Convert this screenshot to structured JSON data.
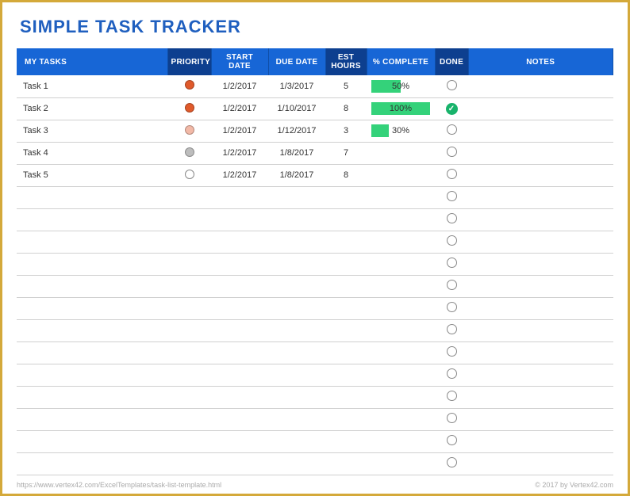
{
  "title": "SIMPLE TASK TRACKER",
  "columns": {
    "task": "MY TASKS",
    "priority": "PRIORITY",
    "start": "START DATE",
    "due": "DUE DATE",
    "est": "EST HOURS",
    "pct": "% COMPLETE",
    "done": "DONE",
    "notes": "NOTES"
  },
  "rows": [
    {
      "task": "Task 1",
      "priority": "high",
      "start": "1/2/2017",
      "due": "1/3/2017",
      "est": "5",
      "pct": 50,
      "pct_label": "50%",
      "done": false
    },
    {
      "task": "Task 2",
      "priority": "high",
      "start": "1/2/2017",
      "due": "1/10/2017",
      "est": "8",
      "pct": 100,
      "pct_label": "100%",
      "done": true
    },
    {
      "task": "Task 3",
      "priority": "med",
      "start": "1/2/2017",
      "due": "1/12/2017",
      "est": "3",
      "pct": 30,
      "pct_label": "30%",
      "done": false
    },
    {
      "task": "Task 4",
      "priority": "low",
      "start": "1/2/2017",
      "due": "1/8/2017",
      "est": "7",
      "pct": null,
      "pct_label": "",
      "done": false
    },
    {
      "task": "Task 5",
      "priority": "none",
      "start": "1/2/2017",
      "due": "1/8/2017",
      "est": "8",
      "pct": null,
      "pct_label": "",
      "done": false
    },
    {
      "task": "",
      "priority": "",
      "start": "",
      "due": "",
      "est": "",
      "pct": null,
      "pct_label": "",
      "done": false
    },
    {
      "task": "",
      "priority": "",
      "start": "",
      "due": "",
      "est": "",
      "pct": null,
      "pct_label": "",
      "done": false
    },
    {
      "task": "",
      "priority": "",
      "start": "",
      "due": "",
      "est": "",
      "pct": null,
      "pct_label": "",
      "done": false
    },
    {
      "task": "",
      "priority": "",
      "start": "",
      "due": "",
      "est": "",
      "pct": null,
      "pct_label": "",
      "done": false
    },
    {
      "task": "",
      "priority": "",
      "start": "",
      "due": "",
      "est": "",
      "pct": null,
      "pct_label": "",
      "done": false
    },
    {
      "task": "",
      "priority": "",
      "start": "",
      "due": "",
      "est": "",
      "pct": null,
      "pct_label": "",
      "done": false
    },
    {
      "task": "",
      "priority": "",
      "start": "",
      "due": "",
      "est": "",
      "pct": null,
      "pct_label": "",
      "done": false
    },
    {
      "task": "",
      "priority": "",
      "start": "",
      "due": "",
      "est": "",
      "pct": null,
      "pct_label": "",
      "done": false
    },
    {
      "task": "",
      "priority": "",
      "start": "",
      "due": "",
      "est": "",
      "pct": null,
      "pct_label": "",
      "done": false
    },
    {
      "task": "",
      "priority": "",
      "start": "",
      "due": "",
      "est": "",
      "pct": null,
      "pct_label": "",
      "done": false
    },
    {
      "task": "",
      "priority": "",
      "start": "",
      "due": "",
      "est": "",
      "pct": null,
      "pct_label": "",
      "done": false
    },
    {
      "task": "",
      "priority": "",
      "start": "",
      "due": "",
      "est": "",
      "pct": null,
      "pct_label": "",
      "done": false
    },
    {
      "task": "",
      "priority": "",
      "start": "",
      "due": "",
      "est": "",
      "pct": null,
      "pct_label": "",
      "done": false
    }
  ],
  "footer": {
    "left": "https://www.vertex42.com/ExcelTemplates/task-list-template.html",
    "right": "© 2017 by Vertex42.com"
  }
}
